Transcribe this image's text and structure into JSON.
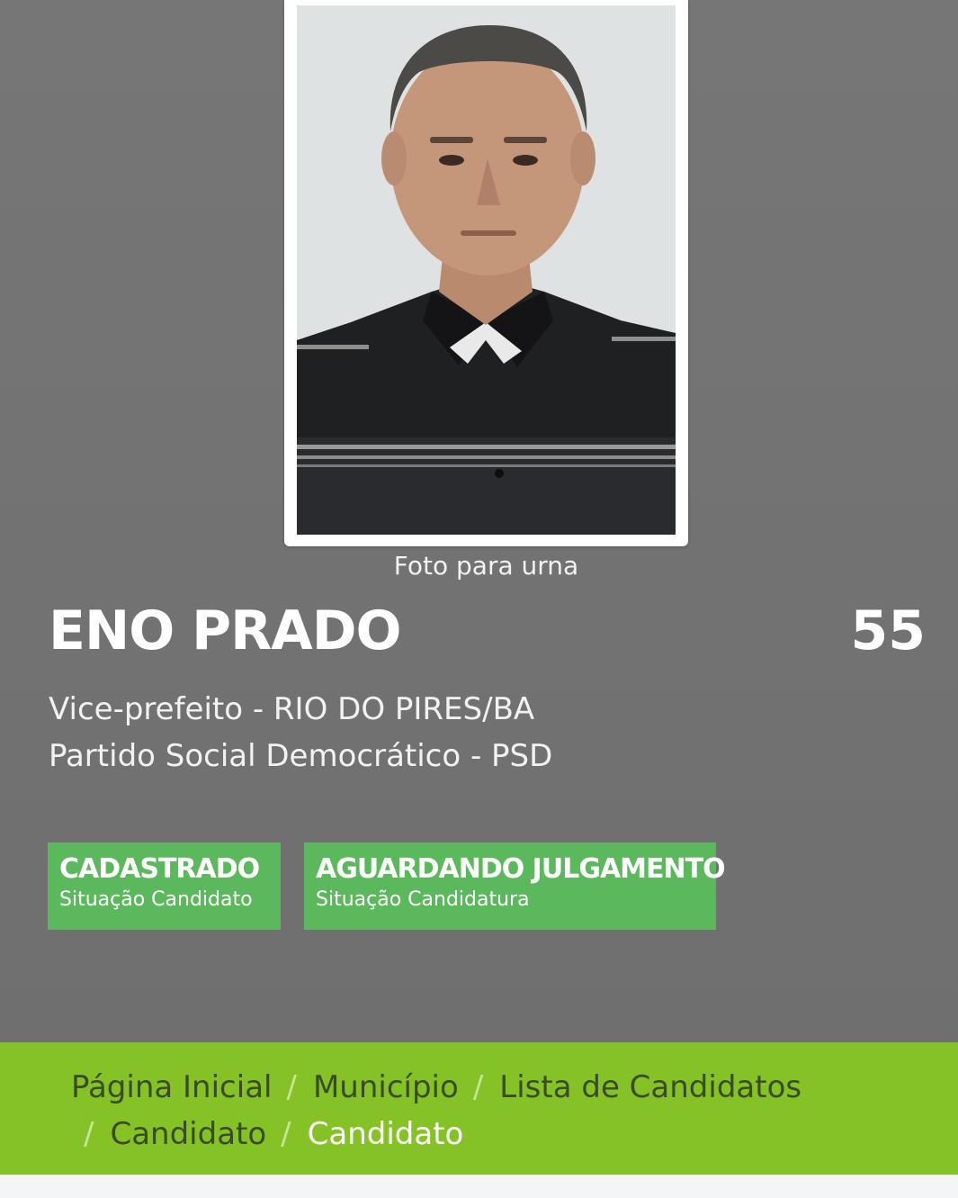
{
  "photo": {
    "caption": "Foto para urna"
  },
  "candidate": {
    "name": "ENO PRADO",
    "number": "55",
    "office_line": "Vice-prefeito - RIO DO PIRES/BA",
    "party_line": "Partido Social Democrático - PSD"
  },
  "status": [
    {
      "title": "CADASTRADO",
      "subtitle": "Situação Candidato"
    },
    {
      "title": "AGUARDANDO JULGAMENTO",
      "subtitle": "Situação Candidatura"
    }
  ],
  "breadcrumb": {
    "items": [
      "Página Inicial",
      "Município",
      "Lista de Candidatos",
      "Candidato",
      "Candidato"
    ],
    "separator": "/"
  },
  "colors": {
    "header_bg": "#767676",
    "badge_green": "#5cb85c",
    "breadcrumb_bg": "#85c226"
  }
}
